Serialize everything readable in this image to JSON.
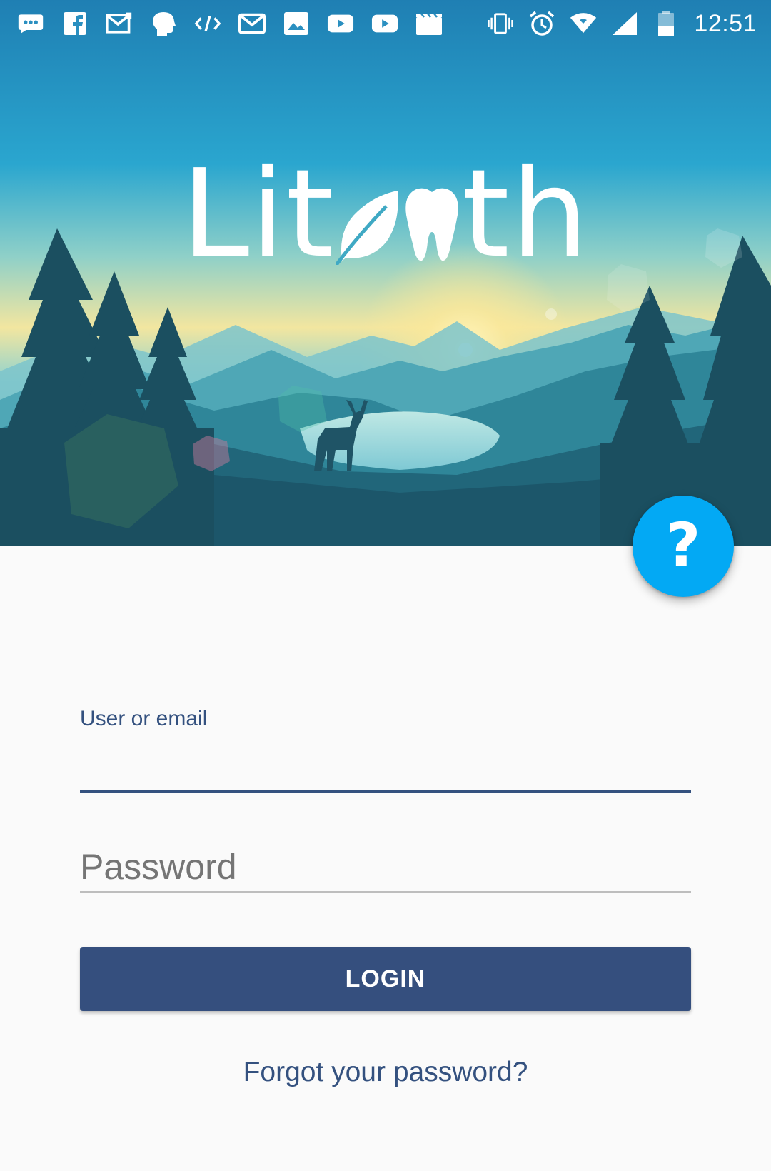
{
  "status_bar": {
    "time": "12:51",
    "left_icons": [
      "chat-bubble-icon",
      "facebook-icon",
      "mail-alert-icon",
      "head-icon",
      "code-icon",
      "gmail-icon",
      "image-icon",
      "youtube-icon",
      "youtube-icon",
      "clapperboard-icon"
    ],
    "right_icons": [
      "vibrate-icon",
      "alarm-icon",
      "wifi-icon",
      "signal-icon",
      "battery-icon"
    ]
  },
  "logo": {
    "prefix": "Lit",
    "suffix": "th",
    "icons": [
      "leaf-icon",
      "tooth-icon"
    ]
  },
  "help_button": {
    "label": "?"
  },
  "form": {
    "user_label": "User or email",
    "user_value": "",
    "password_placeholder": "Password",
    "login_label": "LOGIN",
    "forgot_label": "Forgot your password?"
  },
  "colors": {
    "primary": "#354f7e",
    "accent": "#03a9f4",
    "background": "#fafafa"
  }
}
